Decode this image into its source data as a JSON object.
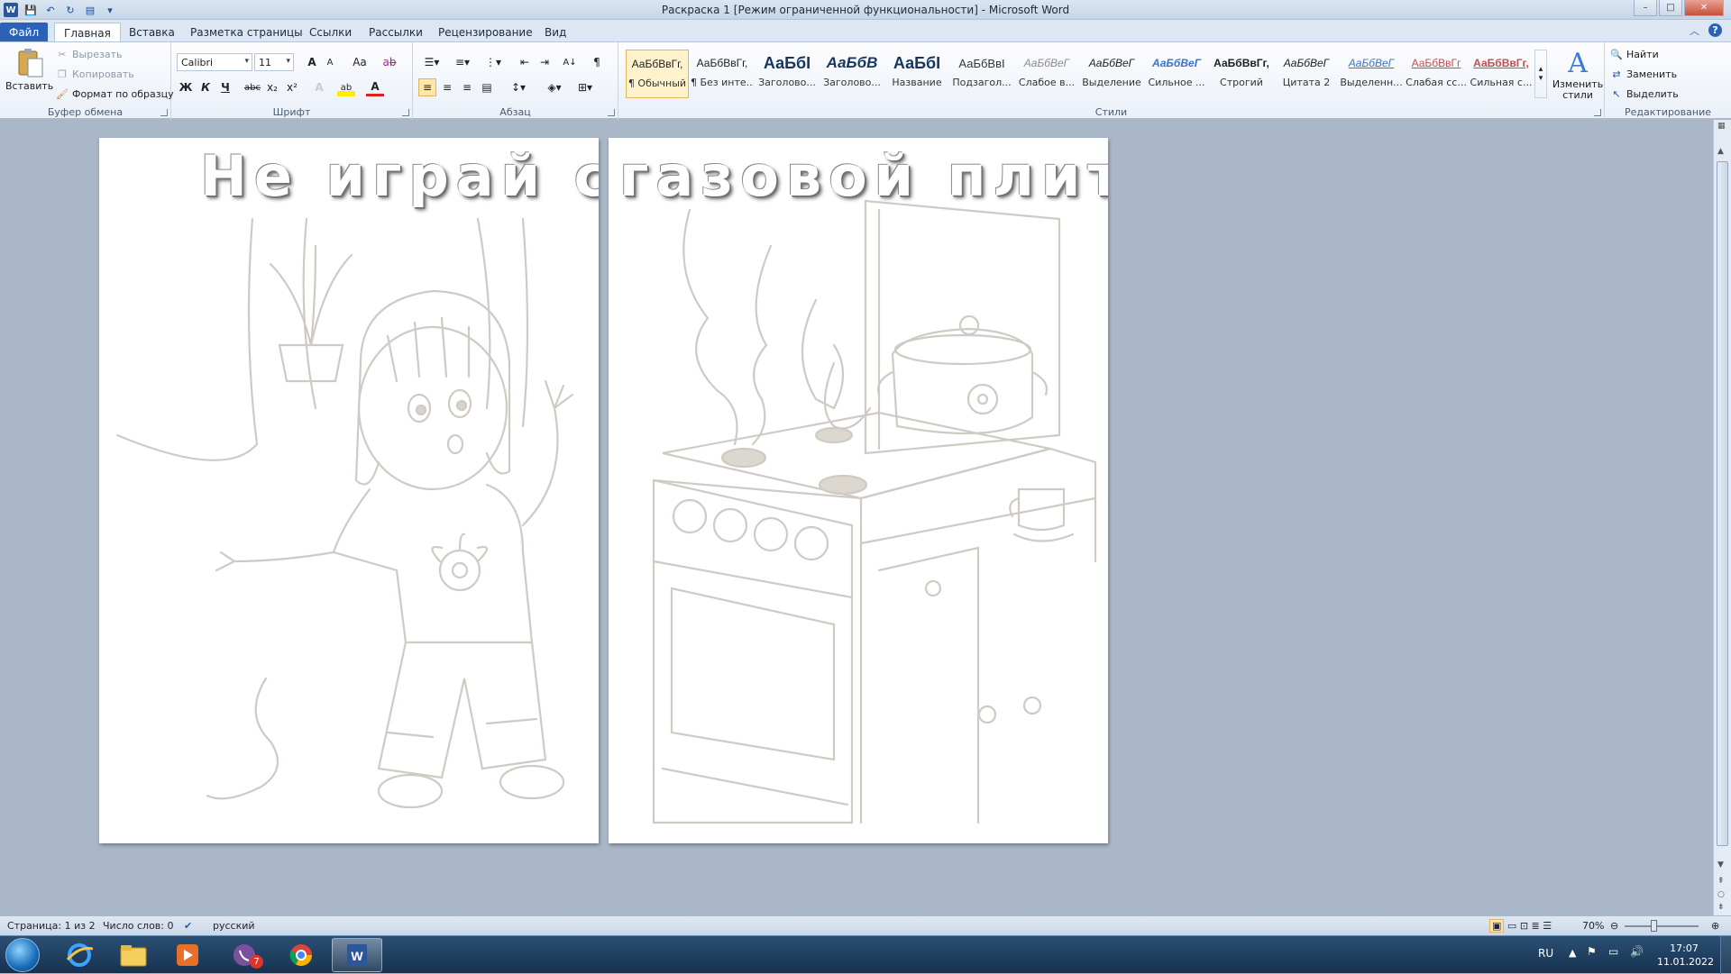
{
  "window": {
    "title": "Раскраска 1 [Режим ограниченной функциональности]  -  Microsoft Word",
    "controls": {
      "minimize": "–",
      "maximize": "□",
      "close": "✕"
    }
  },
  "quick_access": {
    "app_icon": "W",
    "save": "💾",
    "undo": "↶",
    "redo": "↻",
    "print": "▤",
    "more": "▾"
  },
  "tabs": [
    "Файл",
    "Главная",
    "Вставка",
    "Разметка страницы",
    "Ссылки",
    "Рассылки",
    "Рецензирование",
    "Вид"
  ],
  "ribbon": {
    "clipboard": {
      "label": "Буфер обмена",
      "paste": "Вставить",
      "cut": "Вырезать",
      "copy": "Копировать",
      "format_painter": "Формат по образцу"
    },
    "font": {
      "label": "Шрифт",
      "family": "Calibri",
      "size": "11",
      "bold": "Ж",
      "italic": "К",
      "underline": "Ч",
      "strike": "abc",
      "sub": "x₂",
      "sup": "x²",
      "grow": "A",
      "shrink": "A",
      "case": "Aa",
      "clear": "A",
      "highlight": "ab",
      "color": "A"
    },
    "paragraph": {
      "label": "Абзац",
      "marks": "¶",
      "sort": "А↓"
    },
    "styles": {
      "label": "Стили",
      "items": [
        {
          "preview": "АаБбВвГг,",
          "name": "¶ Обычный"
        },
        {
          "preview": "АаБбВвГг,",
          "name": "¶ Без инте..."
        },
        {
          "preview": "АаБбI",
          "name": "Заголово..."
        },
        {
          "preview": "АаБбВ",
          "name": "Заголово..."
        },
        {
          "preview": "АаБбI",
          "name": "Название"
        },
        {
          "preview": "АаБбВвI",
          "name": "Подзагол..."
        },
        {
          "preview": "АаБбВеГ",
          "name": "Слабое в..."
        },
        {
          "preview": "АаБбВеГ",
          "name": "Выделение"
        },
        {
          "preview": "АаБбВеГ",
          "name": "Сильное ..."
        },
        {
          "preview": "АаБбВвГг,",
          "name": "Строгий"
        },
        {
          "preview": "АаБбВеГ",
          "name": "Цитата 2"
        },
        {
          "preview": "АаБбВеГ",
          "name": "Выделенн..."
        },
        {
          "preview": "АаБбВвГг",
          "name": "Слабая сс..."
        },
        {
          "preview": "АаБбВвГг,",
          "name": "Сильная с..."
        }
      ],
      "change": "Изменить стили"
    },
    "editing": {
      "label": "Редактирование",
      "find": "Найти",
      "replace": "Заменить",
      "select": "Выделить"
    }
  },
  "document": {
    "page1_heading": "Не играй  с",
    "page2_heading": "газовой плитой"
  },
  "statusbar": {
    "page": "Страница: 1 из 2",
    "words": "Число слов: 0",
    "language": "русский",
    "zoom": "70%"
  },
  "taskbar": {
    "lang": "RU",
    "time": "17:07",
    "date": "11.01.2022",
    "viber_badge": "7"
  }
}
